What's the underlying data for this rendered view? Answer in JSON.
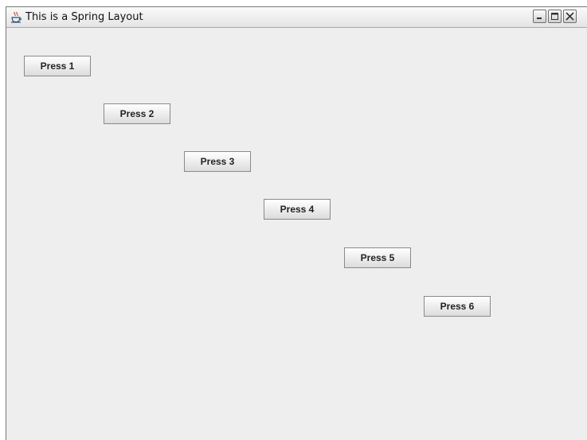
{
  "window": {
    "title": "This is a Spring Layout",
    "controls": {
      "minimize": "minimize-icon",
      "maximize": "maximize-icon",
      "close": "close-icon"
    }
  },
  "buttons": [
    {
      "label": "Press 1"
    },
    {
      "label": "Press 2"
    },
    {
      "label": "Press 3"
    },
    {
      "label": "Press 4"
    },
    {
      "label": "Press 5"
    },
    {
      "label": "Press 6"
    }
  ]
}
